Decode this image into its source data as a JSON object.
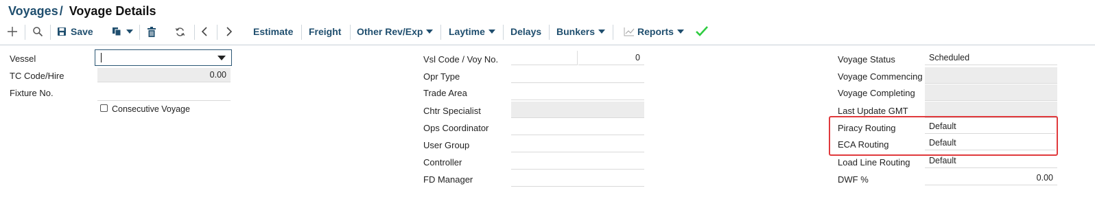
{
  "header": {
    "breadcrumb": "Voyages",
    "separator": "/",
    "title": "Voyage Details"
  },
  "toolbar": {
    "save_label": "Save",
    "estimate_label": "Estimate",
    "freight_label": "Freight",
    "other_rev_label": "Other Rev/Exp",
    "laytime_label": "Laytime",
    "delays_label": "Delays",
    "bunkers_label": "Bunkers",
    "reports_label": "Reports",
    "icons": [
      "add-icon",
      "search-icon",
      "save-icon",
      "copy-icon",
      "chevron-down-icon",
      "delete-icon",
      "refresh-icon",
      "chevron-left-icon",
      "chevron-right-icon",
      "chart-icon",
      "check-icon"
    ],
    "colors": {
      "accent": "#1f4e6e",
      "check": "#2ecc40",
      "highlight": "#e0393c"
    }
  },
  "left": {
    "vessel_label": "Vessel",
    "vessel_value": "",
    "tc_code_label": "TC Code/Hire",
    "tc_value": "0.00",
    "fixture_label": "Fixture No.",
    "fixture_value": "",
    "consecutive_label": "Consecutive Voyage"
  },
  "middle": {
    "vsl_code_label": "Vsl Code / Voy No.",
    "voy_no_value": "0",
    "opr_type_label": "Opr Type",
    "trade_area_label": "Trade Area",
    "chtr_specialist_label": "Chtr Specialist",
    "ops_coordinator_label": "Ops Coordinator",
    "user_group_label": "User Group",
    "controller_label": "Controller",
    "fd_manager_label": "FD Manager"
  },
  "right": {
    "voyage_status_label": "Voyage Status",
    "voyage_status_value": "Scheduled",
    "voyage_commencing_label": "Voyage Commencing",
    "voyage_completing_label": "Voyage Completing",
    "last_update_label": "Last Update GMT",
    "piracy_routing_label": "Piracy Routing",
    "piracy_routing_value": "Default",
    "eca_routing_label": "ECA Routing",
    "eca_routing_value": "Default",
    "load_line_label": "Load Line Routing",
    "load_line_value": "Default",
    "dwf_label": "DWF %",
    "dwf_value": "0.00"
  }
}
